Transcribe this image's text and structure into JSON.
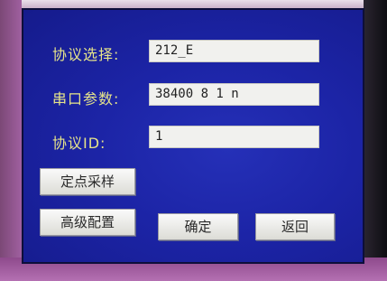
{
  "form": {
    "protocol_select": {
      "label": "协议选择:",
      "value": "212_E"
    },
    "serial_params": {
      "label": "串口参数:",
      "value": "38400 8 1 n"
    },
    "protocol_id": {
      "label": "协议ID:",
      "value": "1"
    }
  },
  "buttons": {
    "fixed_point_sampling": "定点采样",
    "advanced_config": "高级配置",
    "confirm": "确定",
    "back": "返回"
  }
}
